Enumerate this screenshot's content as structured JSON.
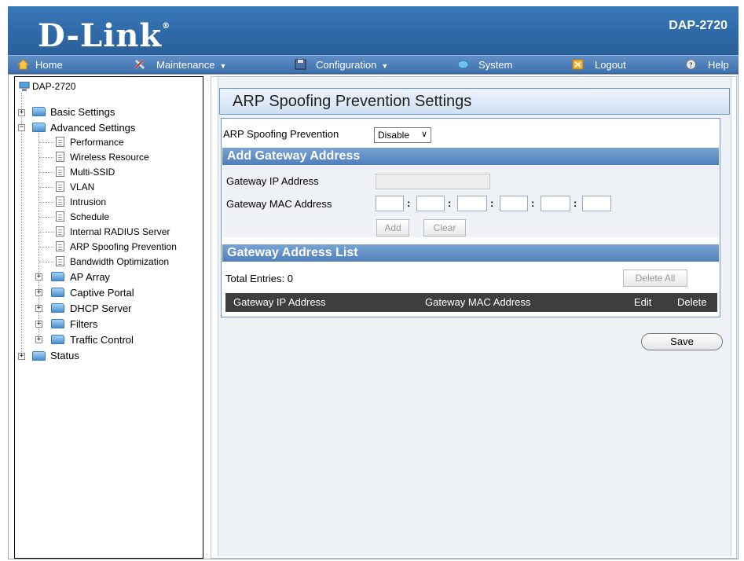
{
  "header": {
    "logo": "D-Link",
    "model": "DAP-2720"
  },
  "nav": {
    "home": "Home",
    "maintenance": "Maintenance",
    "configuration": "Configuration",
    "system": "System",
    "logout": "Logout",
    "help": "Help"
  },
  "tree": {
    "root": "DAP-2720",
    "basic_settings": "Basic Settings",
    "advanced_settings": "Advanced Settings",
    "advanced_items": [
      "Performance",
      "Wireless Resource",
      "Multi-SSID",
      "VLAN",
      "Intrusion",
      "Schedule",
      "Internal RADIUS Server",
      "ARP Spoofing Prevention",
      "Bandwidth Optimization"
    ],
    "advanced_folders": [
      "AP Array",
      "Captive Portal",
      "DHCP Server",
      "Filters",
      "Traffic Control"
    ],
    "status": "Status"
  },
  "main": {
    "title": "ARP Spoofing Prevention Settings",
    "arp_label": "ARP Spoofing Prevention",
    "arp_value": "Disable",
    "add_gateway_heading": "Add Gateway Address",
    "gateway_ip_label": "Gateway IP Address",
    "gateway_mac_label": "Gateway MAC Address",
    "mac_separator": ":",
    "add_button": "Add",
    "clear_button": "Clear",
    "list_heading": "Gateway Address List",
    "total_entries": "Total Entries: 0",
    "delete_all_button": "Delete All",
    "columns": [
      "Gateway IP Address",
      "Gateway MAC Address",
      "Edit",
      "Delete"
    ],
    "save_button": "Save"
  },
  "colors": {
    "header_blue": "#2f6aa8",
    "section_blue": "#4f7fbc",
    "table_head": "#3e3e3e"
  }
}
